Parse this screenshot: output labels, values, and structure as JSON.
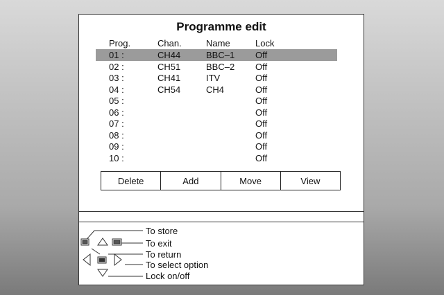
{
  "title": "Programme edit",
  "columns": [
    "Prog.",
    "Chan.",
    "Name",
    "Lock"
  ],
  "rows": [
    {
      "prog": "01 :",
      "chan": "CH44",
      "name": "BBC–1",
      "lock": "Off"
    },
    {
      "prog": "02 :",
      "chan": "CH51",
      "name": "BBC–2",
      "lock": "Off"
    },
    {
      "prog": "03 :",
      "chan": "CH41",
      "name": "ITV",
      "lock": "Off"
    },
    {
      "prog": "04 :",
      "chan": "CH54",
      "name": "CH4",
      "lock": "Off"
    },
    {
      "prog": "05 :",
      "chan": "",
      "name": "",
      "lock": "Off"
    },
    {
      "prog": "06 :",
      "chan": "",
      "name": "",
      "lock": "Off"
    },
    {
      "prog": "07 :",
      "chan": "",
      "name": "",
      "lock": "Off"
    },
    {
      "prog": "08 :",
      "chan": "",
      "name": "",
      "lock": "Off"
    },
    {
      "prog": "09 :",
      "chan": "",
      "name": "",
      "lock": "Off"
    },
    {
      "prog": "10 :",
      "chan": "",
      "name": "",
      "lock": "Off"
    }
  ],
  "buttons": [
    "Delete",
    "Add",
    "Move",
    "View"
  ],
  "help": [
    "To store",
    "To exit",
    "To return",
    "To select option",
    "Lock on/off"
  ]
}
